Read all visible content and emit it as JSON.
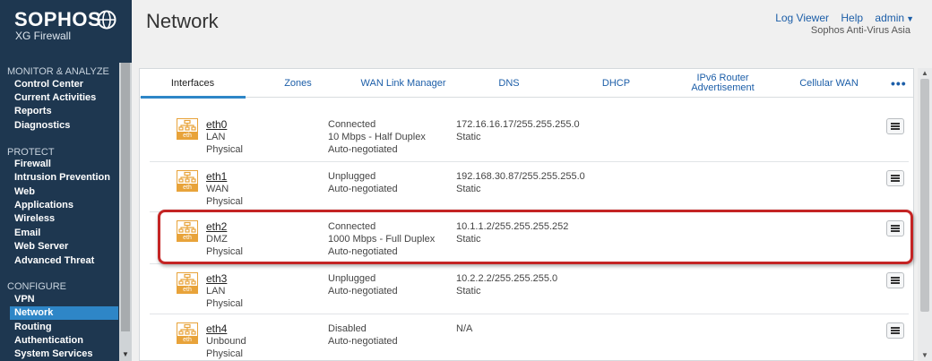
{
  "brand": {
    "name": "SOPHOS",
    "product": "XG Firewall"
  },
  "header": {
    "title": "Network",
    "links": [
      "Log Viewer",
      "Help",
      "admin"
    ],
    "org": "Sophos Anti-Virus Asia"
  },
  "sidebar": {
    "sections": [
      {
        "title": "MONITOR & ANALYZE",
        "items": [
          "Control Center",
          "Current Activities",
          "Reports",
          "Diagnostics"
        ]
      },
      {
        "title": "PROTECT",
        "items": [
          "Firewall",
          "Intrusion Prevention",
          "Web",
          "Applications",
          "Wireless",
          "Email",
          "Web Server",
          "Advanced Threat"
        ]
      },
      {
        "title": "CONFIGURE",
        "items": [
          "VPN",
          "Network",
          "Routing",
          "Authentication",
          "System Services"
        ]
      }
    ],
    "active": "Network"
  },
  "tabs": [
    "Interfaces",
    "Zones",
    "WAN Link Manager",
    "DNS",
    "DHCP",
    "IPv6 Router Advertisement",
    "Cellular WAN"
  ],
  "active_tab": "Interfaces",
  "icon_label": "eth",
  "interfaces": [
    {
      "name": "eth0",
      "zone": "LAN",
      "type": "Physical",
      "status": [
        "Connected",
        "10 Mbps - Half Duplex",
        "Auto-negotiated"
      ],
      "ip": "172.16.16.17/255.255.255.0",
      "mode": "Static"
    },
    {
      "name": "eth1",
      "zone": "WAN",
      "type": "Physical",
      "status": [
        "Unplugged",
        "Auto-negotiated"
      ],
      "ip": "192.168.30.87/255.255.255.0",
      "mode": "Static"
    },
    {
      "name": "eth2",
      "zone": "DMZ",
      "type": "Physical",
      "status": [
        "Connected",
        "1000 Mbps - Full Duplex",
        "Auto-negotiated"
      ],
      "ip": "10.1.1.2/255.255.255.252",
      "mode": "Static"
    },
    {
      "name": "eth3",
      "zone": "LAN",
      "type": "Physical",
      "status": [
        "Unplugged",
        "Auto-negotiated"
      ],
      "ip": "10.2.2.2/255.255.255.0",
      "mode": "Static"
    },
    {
      "name": "eth4",
      "zone": "Unbound",
      "type": "Physical",
      "status": [
        "Disabled",
        "Auto-negotiated"
      ],
      "ip": "N/A",
      "mode": ""
    }
  ],
  "colors": {
    "sidebar": "#1e3750",
    "accent": "#2e86c7",
    "link": "#1c5ea8",
    "icon": "#e8a33a",
    "highlight": "#c42424"
  }
}
